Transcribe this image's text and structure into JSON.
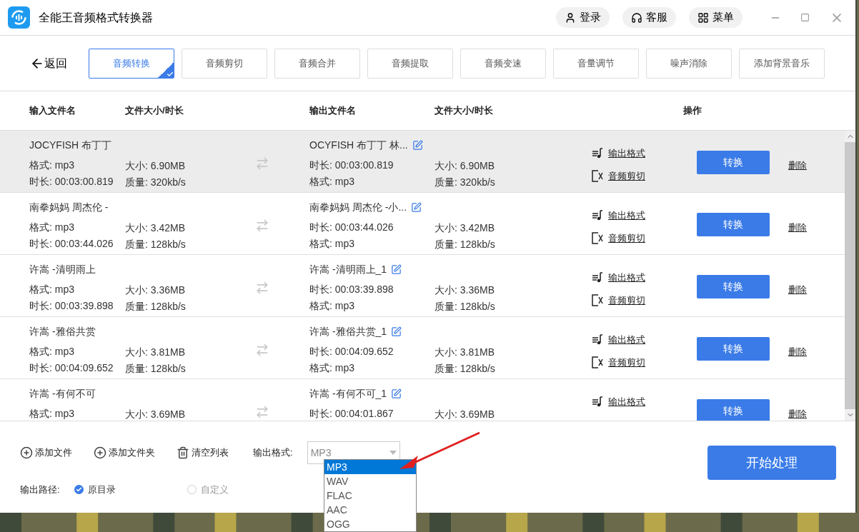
{
  "window": {
    "title": "全能王音频格式转换器",
    "header_buttons": [
      {
        "kind": "user",
        "label": "登录"
      },
      {
        "kind": "headset",
        "label": "客服"
      },
      {
        "kind": "grid",
        "label": "菜单"
      }
    ]
  },
  "back": {
    "label": "返回"
  },
  "tabs": [
    {
      "label": "音频转换",
      "selected": true
    },
    {
      "label": "音频剪切",
      "selected": false
    },
    {
      "label": "音频合并",
      "selected": false
    },
    {
      "label": "音频提取",
      "selected": false
    },
    {
      "label": "音频变速",
      "selected": false
    },
    {
      "label": "音量调节",
      "selected": false
    },
    {
      "label": "噪声消除",
      "selected": false
    },
    {
      "label": "添加背景音乐",
      "selected": false
    }
  ],
  "table": {
    "columns": [
      "输入文件名",
      "文件大小/时长",
      "输出文件名",
      "文件大小/时长",
      "操作"
    ],
    "rows": [
      {
        "selected": true,
        "name": "JOCYFISH 布丁丁",
        "format": "格式: mp3",
        "duration": "时长: 00:03:00.819",
        "size": "大小: 6.90MB",
        "quality": "质量: 320kb/s",
        "out_name": "OCYFISH 布丁丁 林...",
        "out_duration": "时长: 00:03:00.819",
        "out_format": "格式: mp3",
        "out_size": "大小: 6.90MB",
        "out_quality": "质量: 320kb/s",
        "format_link": "输出格式",
        "cut_link": "音频剪切",
        "convert": "转换",
        "delete": "删除"
      },
      {
        "selected": false,
        "name": "南拳妈妈 周杰伦 -",
        "format": "格式: mp3",
        "duration": "时长: 00:03:44.026",
        "size": "大小: 3.42MB",
        "quality": "质量: 128kb/s",
        "out_name": "南拳妈妈 周杰伦 -小...",
        "out_duration": "时长: 00:03:44.026",
        "out_format": "格式: mp3",
        "out_size": "大小: 3.42MB",
        "out_quality": "质量: 128kb/s",
        "format_link": "输出格式",
        "cut_link": "音频剪切",
        "convert": "转换",
        "delete": "删除"
      },
      {
        "selected": false,
        "name": "许嵩 -清明雨上",
        "format": "格式: mp3",
        "duration": "时长: 00:03:39.898",
        "size": "大小: 3.36MB",
        "quality": "质量: 128kb/s",
        "out_name": "许嵩 -清明雨上_1",
        "out_duration": "时长: 00:03:39.898",
        "out_format": "格式: mp3",
        "out_size": "大小: 3.36MB",
        "out_quality": "质量: 128kb/s",
        "format_link": "输出格式",
        "cut_link": "音频剪切",
        "convert": "转换",
        "delete": "删除"
      },
      {
        "selected": false,
        "name": "许嵩 -雅俗共赏",
        "format": "格式: mp3",
        "duration": "时长: 00:04:09.652",
        "size": "大小: 3.81MB",
        "quality": "质量: 128kb/s",
        "out_name": "许嵩 -雅俗共赏_1",
        "out_duration": "时长: 00:04:09.652",
        "out_format": "格式: mp3",
        "out_size": "大小: 3.81MB",
        "out_quality": "质量: 128kb/s",
        "format_link": "输出格式",
        "cut_link": "音频剪切",
        "convert": "转换",
        "delete": "删除"
      },
      {
        "selected": false,
        "name": "许嵩 -有何不可",
        "format": "格式: mp3",
        "size": "大小: 3.69MB",
        "out_name": "许嵩 -有何不可_1",
        "out_duration": "时长: 00:04:01.867",
        "out_size": "大小: 3.69MB",
        "format_link": "输出格式",
        "convert": "转换",
        "delete": "删除"
      }
    ]
  },
  "toolbar": [
    {
      "kind": "add",
      "label": "添加文件"
    },
    {
      "kind": "add",
      "label": "添加文件夹"
    },
    {
      "kind": "trash",
      "label": "清空列表"
    }
  ],
  "output_format": {
    "label": "输出格式:",
    "value": "MP3",
    "options": [
      {
        "label": "MP3",
        "selected": true
      },
      {
        "label": "WAV",
        "selected": false
      },
      {
        "label": "FLAC",
        "selected": false
      },
      {
        "label": "AAC",
        "selected": false
      },
      {
        "label": "OGG",
        "selected": false
      }
    ]
  },
  "output_path": {
    "label": "输出路径:",
    "options": [
      {
        "label": "原目录",
        "selected": true
      },
      {
        "label": "自定义",
        "selected": false
      }
    ]
  },
  "start_button": "开始处理"
}
